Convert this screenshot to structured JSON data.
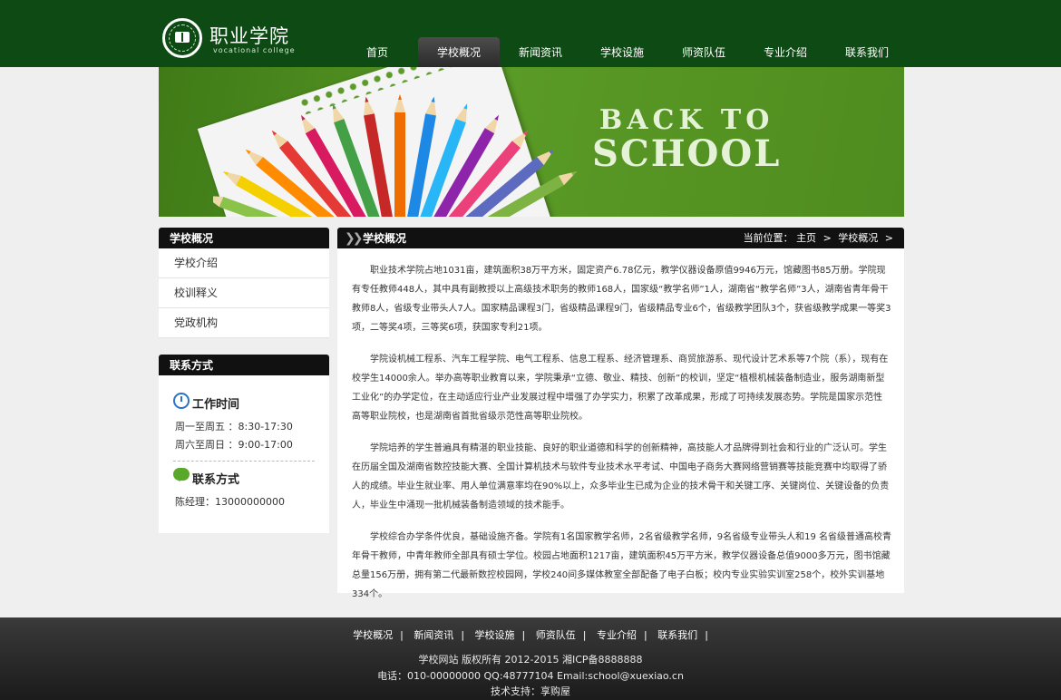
{
  "header": {
    "brand": "职业学院",
    "brand_sub": "vocational college",
    "nav": [
      "首页",
      "学校概况",
      "新闻资讯",
      "学校设施",
      "师资队伍",
      "专业介绍",
      "联系我们"
    ]
  },
  "banner": {
    "line1": "BACK TO",
    "line2": "SCHOOL"
  },
  "sidebar": {
    "about_title": "学校概况",
    "menu": [
      "学校介绍",
      "校训释义",
      "党政机构"
    ],
    "contact_title": "联系方式",
    "work_title": "工作时间",
    "work_lines": [
      "周一至周五 ：8:30-17:30",
      "周六至周日 ：9:00-17:00"
    ],
    "contact_sub_title": "联系方式",
    "contact_line": "陈经理：13000000000"
  },
  "main": {
    "title": "学校概况",
    "crumb_label": "当前位置：",
    "crumb_home": "主页",
    "crumb_sep": ">",
    "crumb_current": "学校概况",
    "paragraphs": [
      "职业技术学院占地1031亩，建筑面积38万平方米，固定资产6.78亿元，教学仪器设备原值9946万元，馆藏图书85万册。学院现有专任教师448人，其中具有副教授以上高级技术职务的教师168人，国家级“教学名师”1人，湖南省“教学名师”3人，湖南省青年骨干教师8人，省级专业带头人7人。国家精品课程3门，省级精品课程9门，省级精品专业6个，省级教学团队3个，获省级教学成果一等奖3项，二等奖4项，三等奖6项，获国家专利21项。",
      "学院设机械工程系、汽车工程学院、电气工程系、信息工程系、经济管理系、商贸旅游系、现代设计艺术系等7个院（系），现有在校学生14000余人。举办高等职业教育以来，学院秉承“立德、敬业、精技、创新”的校训，坚定“植根机械装备制造业，服务湖南新型工业化”的办学定位，在主动适应行业产业发展过程中增强了办学实力，积累了改革成果，形成了可持续发展态势。学院是国家示范性高等职业院校，也是湖南省首批省级示范性高等职业院校。",
      "学院培养的学生普遍具有精湛的职业技能、良好的职业道德和科学的创新精神，高技能人才品牌得到社会和行业的广泛认可。学生在历届全国及湖南省数控技能大赛、全国计算机技术与软件专业技术水平考试、中国电子商务大赛网络营销赛等技能竞赛中均取得了骄人的成绩。毕业生就业率、用人单位满意率均在90%以上，众多毕业生已成为企业的技术骨干和关键工序、关键岗位、关键设备的负责人，毕业生中涌现一批机械装备制造领域的技术能手。",
      "学校综合办学条件优良，基础设施齐备。学院有1名国家教学名师，2名省级教学名师，9名省级专业带头人和19 名省级普通高校青年骨干教师，中青年教师全部具有硕士学位。校园占地面积1217亩，建筑面积45万平方米，教学仪器设备总值9000多万元，图书馆藏总量156万册，拥有第二代最新数控校园网，学校240间多媒体教室全部配备了电子白板；校内专业实验实训室258个，校外实训基地334个。"
    ]
  },
  "footer": {
    "links": [
      "学校概况",
      "新闻资讯",
      "学校设施",
      "师资队伍",
      "专业介绍",
      "联系我们"
    ],
    "sep": "|",
    "copyright": "学校网站 版权所有 2012-2015 湘ICP备8888888",
    "contact": "电话：010-00000000 QQ:48777104 Email:school@xuexiao.cn",
    "support": "技术支持：享购屋"
  }
}
